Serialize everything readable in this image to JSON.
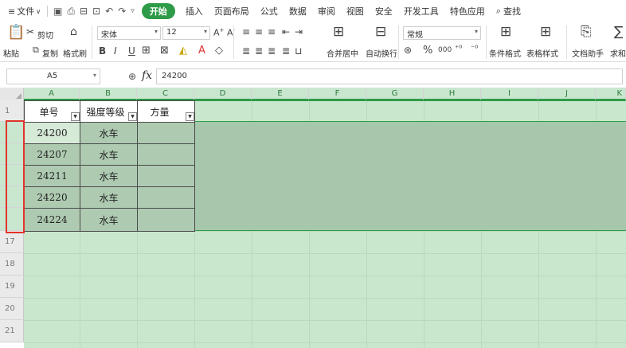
{
  "menu": {
    "file": "文件",
    "tabs": [
      "插入",
      "页面布局",
      "公式",
      "数据",
      "审阅",
      "视图",
      "安全",
      "开发工具",
      "特色应用"
    ],
    "active_tab": "开始",
    "search": "查找"
  },
  "ribbon": {
    "paste": "粘贴",
    "cut": "剪切",
    "copy": "复制",
    "format_painter": "格式刷",
    "font_name": "宋体",
    "font_size": "12",
    "bold": "B",
    "italic": "I",
    "underline": "U",
    "merge_center": "合并居中",
    "wrap_text": "自动换行",
    "number_format": "常规",
    "percent": "%",
    "thousands": "000",
    "conditional_format": "条件格式",
    "table_style": "表格样式",
    "doc_helper": "文档助手",
    "sum": "求和"
  },
  "formula_bar": {
    "name_box": "A5",
    "fx": "fx",
    "value": "24200"
  },
  "columns": [
    "A",
    "B",
    "C",
    "D",
    "E",
    "F",
    "G",
    "H",
    "I",
    "J",
    "K"
  ],
  "rows": [
    "1",
    "",
    "",
    "",
    "",
    "",
    "17",
    "18",
    "19",
    "20",
    "21"
  ],
  "table": {
    "headers": [
      "单号",
      "强度等级",
      "方量"
    ],
    "rows": [
      [
        "24200",
        "水车",
        ""
      ],
      [
        "24207",
        "水车",
        ""
      ],
      [
        "24211",
        "水车",
        ""
      ],
      [
        "24220",
        "水车",
        ""
      ],
      [
        "24224",
        "水车",
        ""
      ]
    ]
  },
  "colors": {
    "accent": "#2e9b48",
    "selection_fill": "#a6c7ab",
    "sheet_fill": "#c9e7cd",
    "highlight_box": "#e0342b"
  }
}
